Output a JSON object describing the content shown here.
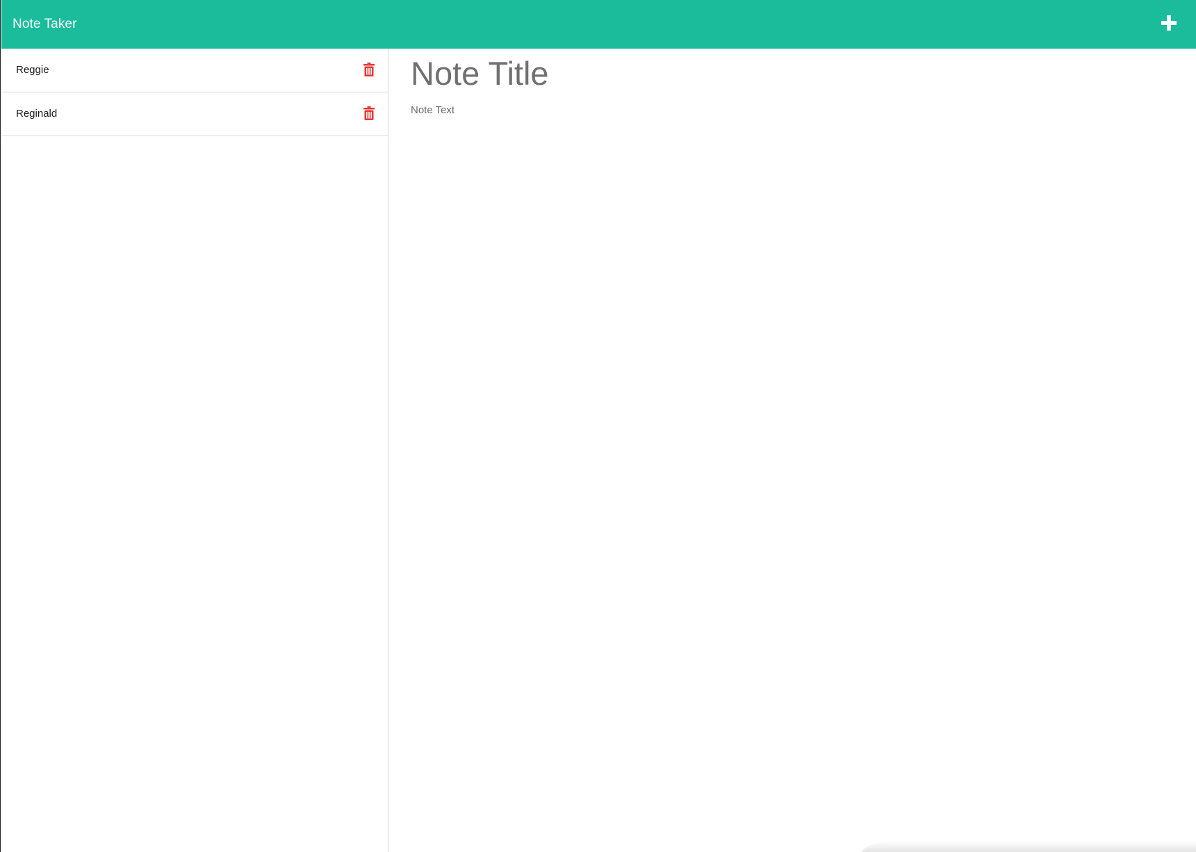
{
  "navbar": {
    "brand": "Note Taker",
    "add_icon": "plus-icon",
    "background_color": "#1abc9c"
  },
  "sidebar": {
    "notes": [
      {
        "title": "Reggie",
        "delete_icon": "trash-icon"
      },
      {
        "title": "Reginald",
        "delete_icon": "trash-icon"
      }
    ],
    "delete_color": "#e53935"
  },
  "editor": {
    "title_placeholder": "Note Title",
    "text_placeholder": "Note Text"
  }
}
